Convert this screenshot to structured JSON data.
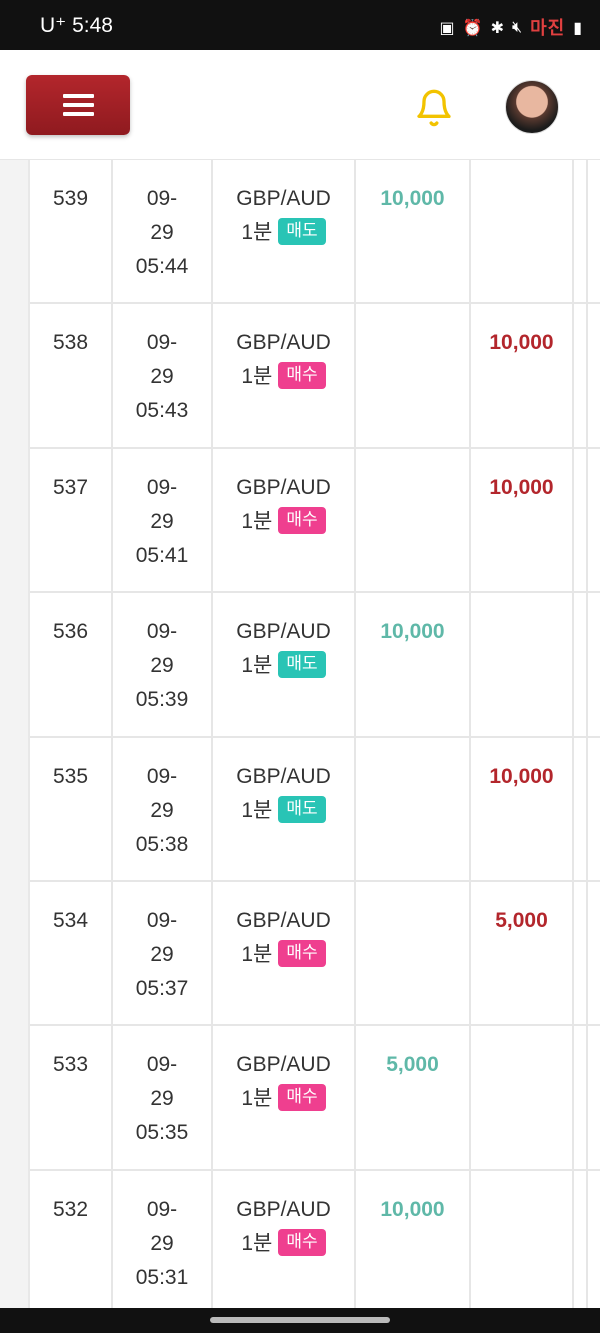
{
  "status_bar": {
    "carrier_time": "U⁺ 5:48",
    "watermark": "마진"
  },
  "header": {
    "menu_icon": "hamburger-icon",
    "bell_icon": "bell-icon",
    "colors": {
      "menu": "#a32229",
      "bell": "#f2c300"
    }
  },
  "colors": {
    "win": "#5fb8a8",
    "lose": "#b3262c",
    "sell_tag": "#29c4b5",
    "buy_tag": "#ef3f8f"
  },
  "rows": [
    {
      "id": "539",
      "date": [
        "09-",
        "29",
        "05:44"
      ],
      "pair": "GBP/AUD",
      "interval": "1분",
      "tag": "매도",
      "tag_type": "sell",
      "win": "10,000",
      "lose": ""
    },
    {
      "id": "538",
      "date": [
        "09-",
        "29",
        "05:43"
      ],
      "pair": "GBP/AUD",
      "interval": "1분",
      "tag": "매수",
      "tag_type": "buy",
      "win": "",
      "lose": "10,000"
    },
    {
      "id": "537",
      "date": [
        "09-",
        "29",
        "05:41"
      ],
      "pair": "GBP/AUD",
      "interval": "1분",
      "tag": "매수",
      "tag_type": "buy",
      "win": "",
      "lose": "10,000"
    },
    {
      "id": "536",
      "date": [
        "09-",
        "29",
        "05:39"
      ],
      "pair": "GBP/AUD",
      "interval": "1분",
      "tag": "매도",
      "tag_type": "sell",
      "win": "10,000",
      "lose": ""
    },
    {
      "id": "535",
      "date": [
        "09-",
        "29",
        "05:38"
      ],
      "pair": "GBP/AUD",
      "interval": "1분",
      "tag": "매도",
      "tag_type": "sell",
      "win": "",
      "lose": "10,000"
    },
    {
      "id": "534",
      "date": [
        "09-",
        "29",
        "05:37"
      ],
      "pair": "GBP/AUD",
      "interval": "1분",
      "tag": "매수",
      "tag_type": "buy",
      "win": "",
      "lose": "5,000"
    },
    {
      "id": "533",
      "date": [
        "09-",
        "29",
        "05:35"
      ],
      "pair": "GBP/AUD",
      "interval": "1분",
      "tag": "매수",
      "tag_type": "buy",
      "win": "5,000",
      "lose": ""
    },
    {
      "id": "532",
      "date": [
        "09-",
        "29",
        "05:31"
      ],
      "pair": "GBP/AUD",
      "interval": "1분",
      "tag": "매수",
      "tag_type": "buy",
      "win": "10,000",
      "lose": ""
    }
  ]
}
